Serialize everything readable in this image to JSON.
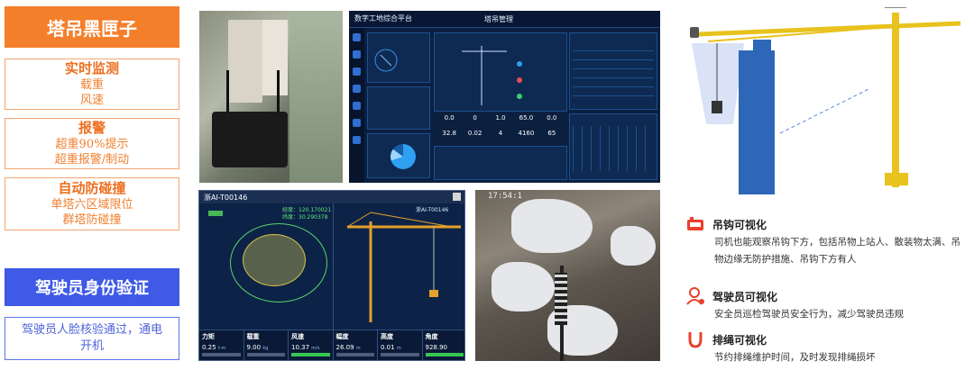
{
  "left": {
    "header": "塔吊黑匣子",
    "boxes": [
      {
        "title": "实时监测",
        "lines": [
          "载重",
          "风速"
        ]
      },
      {
        "title": "报警",
        "lines": [
          "超重90%提示",
          "超重报警/制动"
        ]
      },
      {
        "title": "自动防碰撞",
        "lines": [
          "单塔六区域限位",
          "群塔防碰撞"
        ]
      }
    ],
    "driver_header": "驾驶员身份验证",
    "driver_desc": "驾驶员人脸核验通过，通电开机"
  },
  "dashboard": {
    "app_title": "数字工地综合平台",
    "center_title": "塔吊管理",
    "stats_row1": [
      "0.0",
      "0",
      "1.0",
      "65.0",
      "0.0"
    ],
    "stats_row2": [
      "32.8",
      "0.02",
      "4",
      "4160",
      "65"
    ]
  },
  "monitor": {
    "title": "浙AI-T00146",
    "right_title": "浙AI-T00146",
    "coords": [
      "经度：120.170021",
      "纬度：30.290378"
    ],
    "cells": [
      {
        "label": "力矩",
        "value": "0.25",
        "unit": "t·m"
      },
      {
        "label": "载重",
        "value": "9.00",
        "unit": "kg"
      },
      {
        "label": "风速",
        "value": "10.37",
        "unit": "m/s"
      },
      {
        "label": "幅度",
        "value": "26.09",
        "unit": "m"
      },
      {
        "label": "高度",
        "value": "0.01",
        "unit": "m"
      },
      {
        "label": "角度",
        "value": "928.90",
        "unit": ""
      }
    ]
  },
  "camera": {
    "timestamp": "17:54:1"
  },
  "features": [
    {
      "icon": "hook-camera-icon",
      "title": "吊钩可视化",
      "desc": "司机也能观察吊钩下方，包括吊物上站人、散装物太满、吊物边缘无防护措施、吊钩下方有人",
      "color": "#e8412c"
    },
    {
      "icon": "driver-icon",
      "title": "驾驶员可视化",
      "desc": "安全员巡检驾驶员安全行为，减少驾驶员违规",
      "color": "#e8412c"
    },
    {
      "icon": "rope-icon",
      "title": "排绳可视化",
      "desc": "节约排绳维护时间，及时发现排绳损坏",
      "color": "#e8412c"
    }
  ]
}
